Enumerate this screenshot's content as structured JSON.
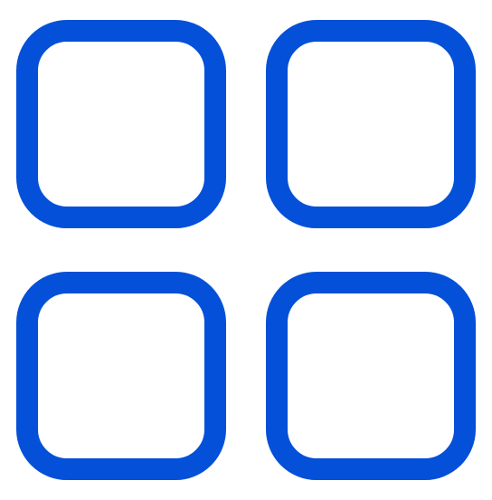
{
  "icon": {
    "name": "grid-icon",
    "color": "#0450d8",
    "background": "#ffffff",
    "tiles": [
      "top-left",
      "top-right",
      "bottom-left",
      "bottom-right"
    ]
  }
}
